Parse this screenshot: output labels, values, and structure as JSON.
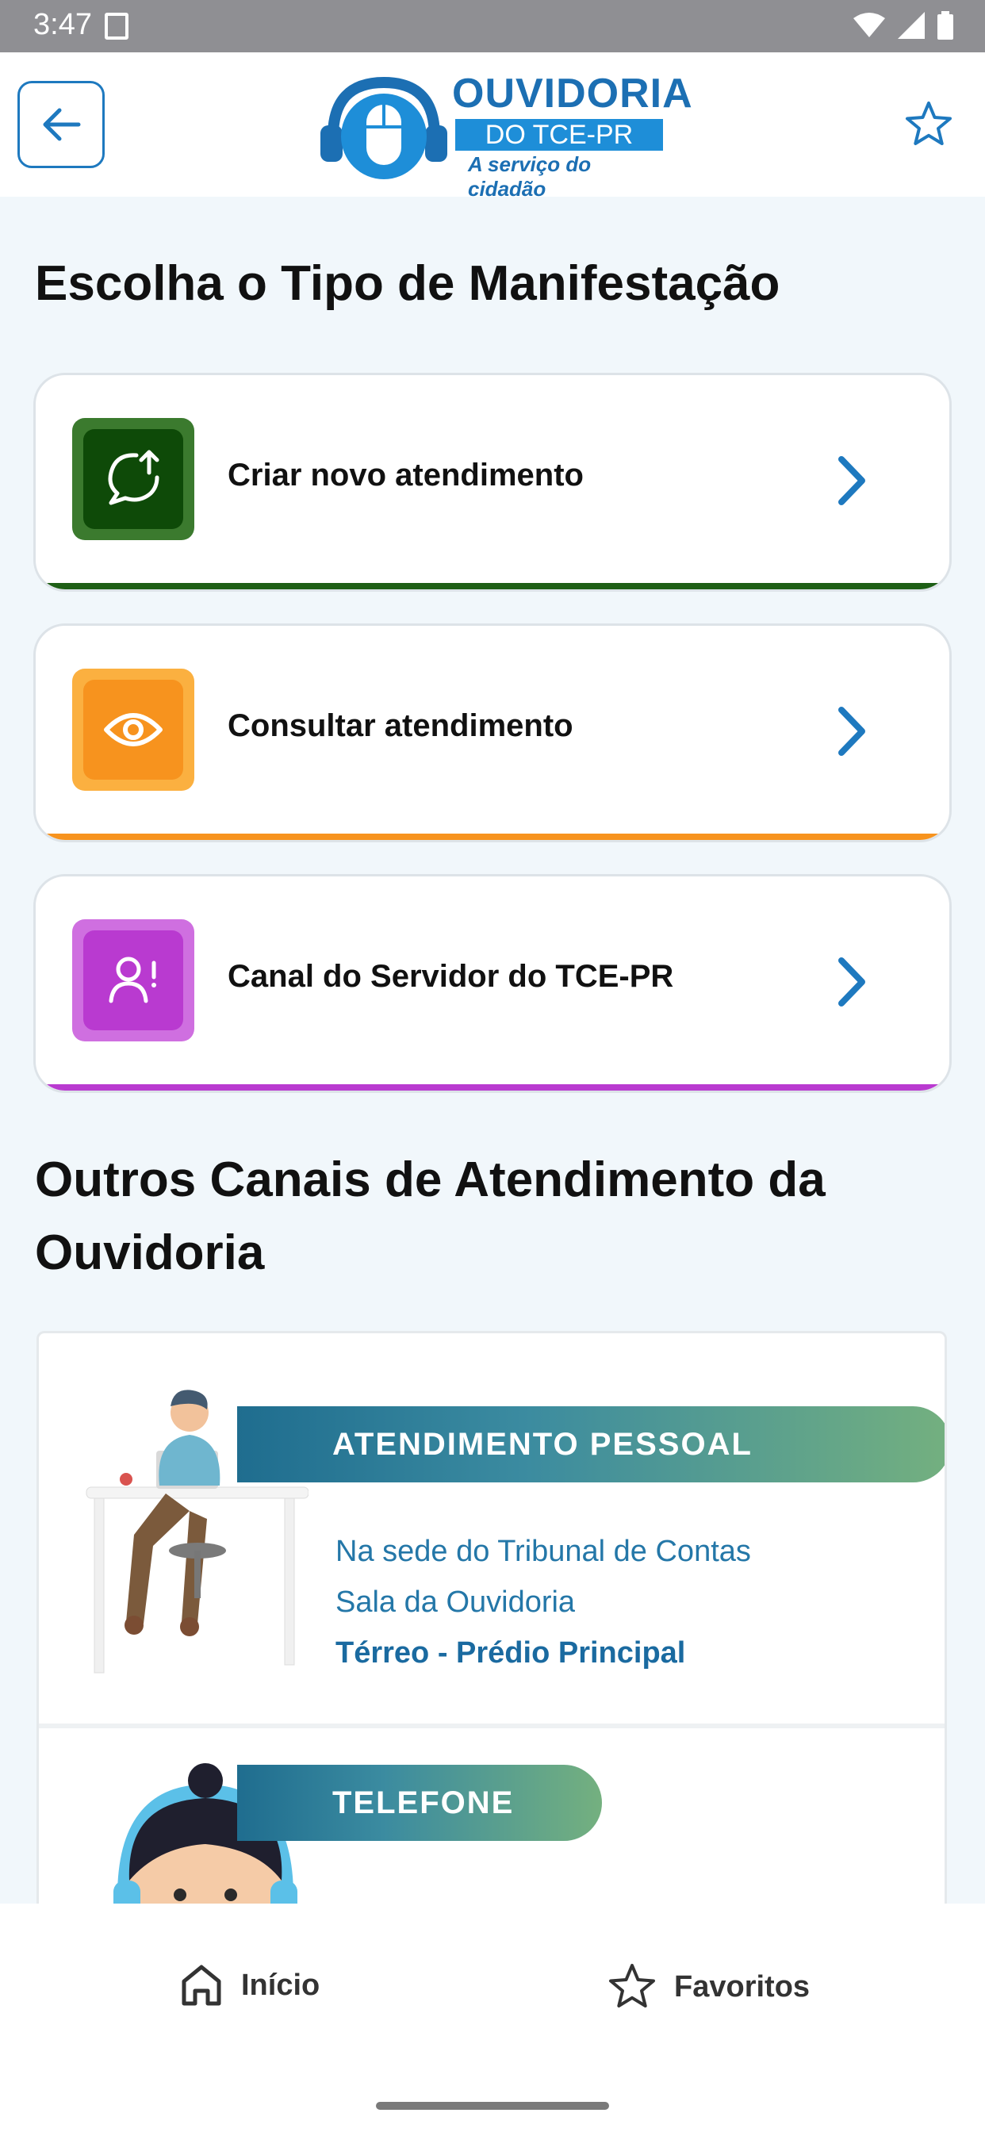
{
  "status_bar": {
    "time": "3:47"
  },
  "header": {
    "logo_title": "OUVIDORIA",
    "logo_subtitle": "DO TCE-PR",
    "logo_tagline": "A serviço do cidadão"
  },
  "section_choose": {
    "title": "Escolha o Tipo de Manifestação"
  },
  "options": [
    {
      "label": "Criar novo atendimento",
      "icon": "chat-upload-icon",
      "color": "#1e5f16"
    },
    {
      "label": "Consultar atendimento",
      "icon": "eye-icon",
      "color": "#f7931e"
    },
    {
      "label": "Canal do Servidor do TCE-PR",
      "icon": "user-alert-icon",
      "color": "#b93ad0"
    }
  ],
  "section_channels": {
    "title_line1": "Outros Canais de Atendimento da",
    "title_line2": "Ouvidoria"
  },
  "channels": {
    "pessoal": {
      "title": "ATENDIMENTO PESSOAL",
      "line1": "Na sede do Tribunal de Contas",
      "line2": "Sala da Ouvidoria",
      "line3": "Térreo - Prédio Principal"
    },
    "telefone": {
      "title": "TELEFONE"
    }
  },
  "bottom_nav": {
    "home": "Início",
    "favorites": "Favoritos"
  },
  "colors": {
    "accent": "#1e79bf",
    "background": "#f1f7fb"
  }
}
